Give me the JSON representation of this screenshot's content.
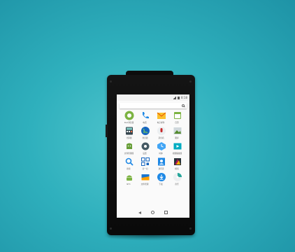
{
  "status_bar": {
    "left_text": "",
    "time": "8:18"
  },
  "apps": [
    {
      "label": "Kiwi浏览器",
      "icon": "browser-icon",
      "color": "#7cb342"
    },
    {
      "label": "电话",
      "icon": "phone-icon",
      "color": "#1e88e5"
    },
    {
      "label": "电子邮件",
      "icon": "email-icon",
      "color": "#fbc02d"
    },
    {
      "label": "日历",
      "icon": "calendar-icon",
      "color": "#7cb342"
    },
    {
      "label": "计算器",
      "icon": "calculator-icon",
      "color": "#37474f"
    },
    {
      "label": "浏览器",
      "icon": "globe-icon",
      "color": "#1565c0"
    },
    {
      "label": "录音机",
      "icon": "recorder-icon",
      "color": "#c62828"
    },
    {
      "label": "图库",
      "icon": "gallery-icon",
      "color": "#558b2f"
    },
    {
      "label": "文件管理器",
      "icon": "files-icon",
      "color": "#689f38"
    },
    {
      "label": "设置",
      "icon": "settings-icon",
      "color": "#455a64"
    },
    {
      "label": "时钟",
      "icon": "clock-icon",
      "color": "#42a5f5"
    },
    {
      "label": "视频播放器",
      "icon": "video-icon",
      "color": "#00acc1"
    },
    {
      "label": "搜索",
      "icon": "search-app-icon",
      "color": "#1e88e5"
    },
    {
      "label": "扫一扫",
      "icon": "qr-icon",
      "color": "#1565c0"
    },
    {
      "label": "通讯录",
      "icon": "contacts-icon",
      "color": "#1e88e5"
    },
    {
      "label": "相机",
      "icon": "camera-icon",
      "color": "#ad1457"
    },
    {
      "label": "NFC",
      "icon": "android-icon",
      "color": "#7cb342"
    },
    {
      "label": "文件管理",
      "icon": "folder-icon",
      "color": "#1976d2"
    },
    {
      "label": "下载",
      "icon": "download-icon",
      "color": "#1e88e5"
    },
    {
      "label": "音乐",
      "icon": "music-icon",
      "color": "#26a69a"
    }
  ]
}
